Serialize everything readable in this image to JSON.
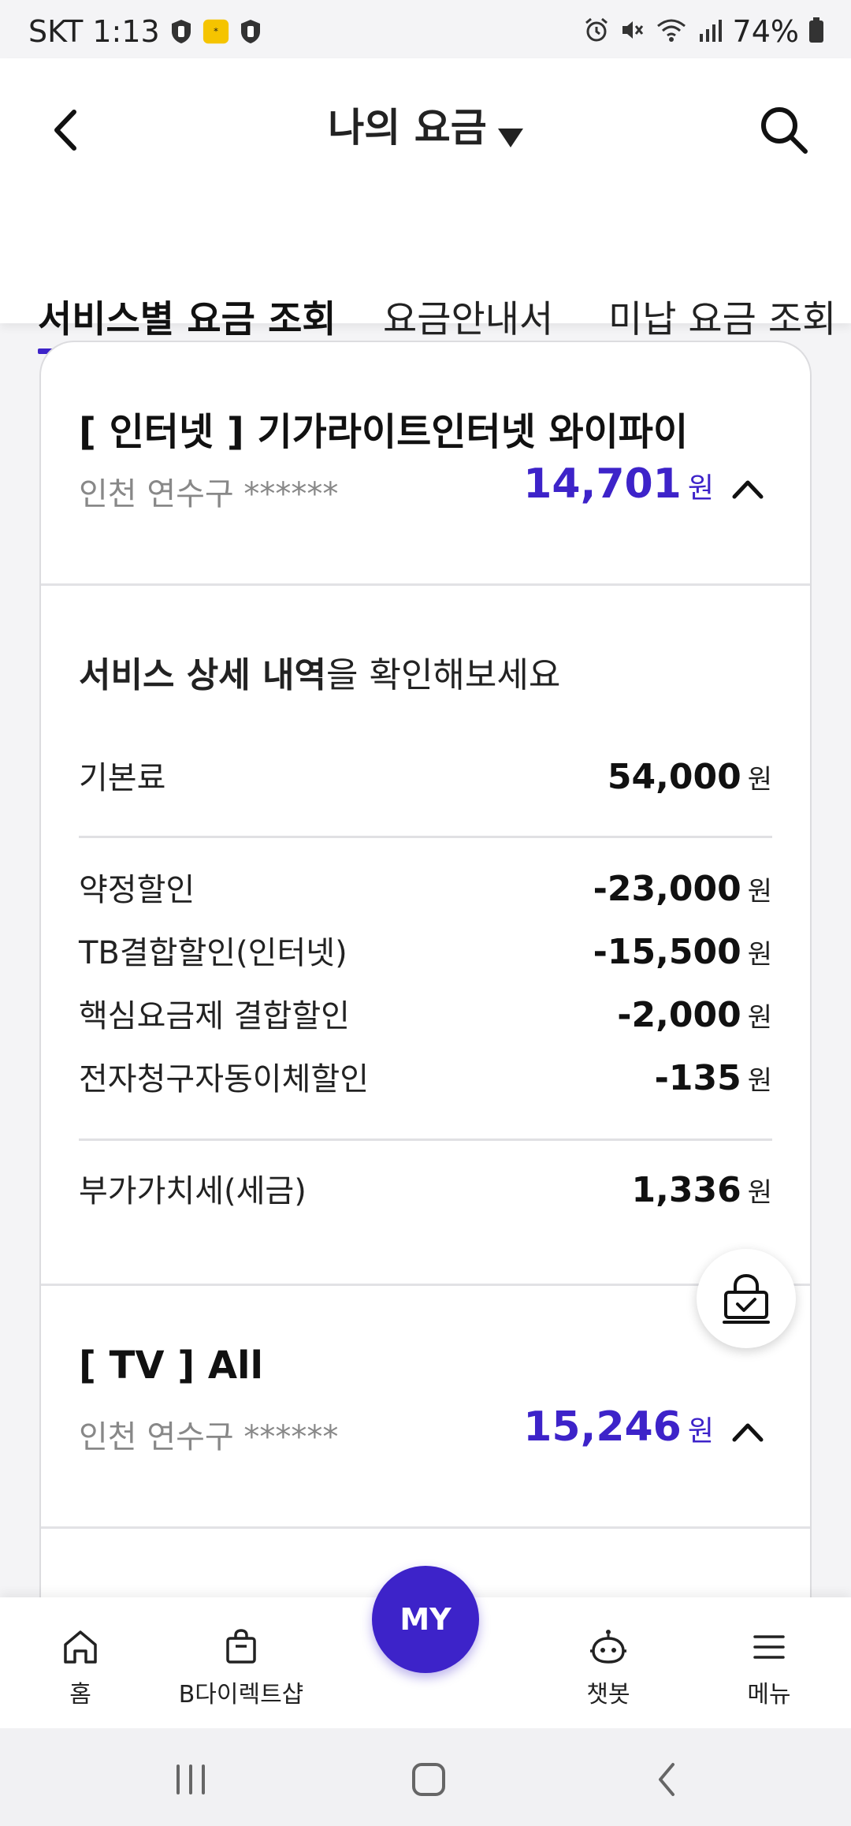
{
  "status_bar": {
    "carrier_time": "SKT 1:13",
    "battery": "74%"
  },
  "header": {
    "title": "나의 요금",
    "tabs": [
      {
        "label": "서비스별 요금 조회",
        "active": true
      },
      {
        "label": "요금안내서",
        "active": false
      },
      {
        "label": "미납 요금 조회",
        "active": false
      }
    ]
  },
  "internet": {
    "title": "[ 인터넷 ] 기가라이트인터넷 와이파이",
    "address": "인천 연수구 ******",
    "amount": "14,701",
    "won": "원"
  },
  "details": {
    "heading_bold": "서비스 상세 내역",
    "heading_rest": "을 확인해보세요",
    "base": {
      "label": "기본료",
      "value": "54,000",
      "won": "원"
    },
    "discounts": [
      {
        "label": "약정할인",
        "value": "-23,000",
        "won": "원"
      },
      {
        "label": "TB결합할인(인터넷)",
        "value": "-15,500",
        "won": "원"
      },
      {
        "label": "핵심요금제 결합할인",
        "value": "-2,000",
        "won": "원"
      },
      {
        "label": "전자청구자동이체할인",
        "value": "-135",
        "won": "원"
      }
    ],
    "vat": {
      "label": "부가가치세(세금)",
      "value": "1,336",
      "won": "원"
    }
  },
  "tv": {
    "title": "[ TV ] All",
    "address": "인천 연수구 ******",
    "amount": "15,246",
    "won": "원"
  },
  "bottom_nav": {
    "items": [
      {
        "label": "홈",
        "icon": "home-icon"
      },
      {
        "label": "B다이렉트샵",
        "icon": "shopping-bag-icon"
      },
      {
        "label": "MY",
        "icon": "my-button"
      },
      {
        "label": "챗봇",
        "icon": "chatbot-icon"
      },
      {
        "label": "메뉴",
        "icon": "menu-icon"
      }
    ]
  },
  "colors": {
    "accent": "#3d23c9"
  }
}
